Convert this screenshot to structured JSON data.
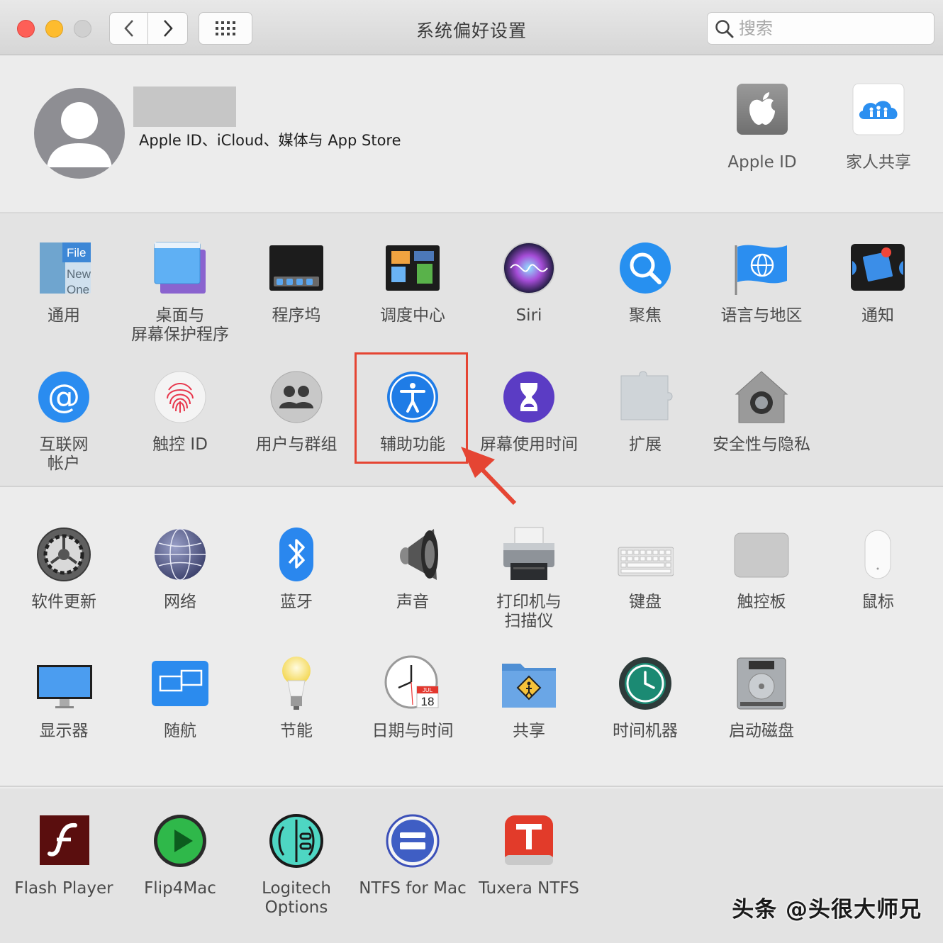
{
  "window": {
    "title": "系统偏好设置"
  },
  "search": {
    "placeholder": "搜索"
  },
  "apple_id": {
    "subtitle": "Apple ID、iCloud、媒体与 App Store"
  },
  "top_items": [
    {
      "label": "Apple ID",
      "icon": "apple-logo-icon"
    },
    {
      "label": "家人共享",
      "icon": "family-sharing-icon"
    }
  ],
  "prefs": [
    {
      "label": "通用",
      "icon": "general-icon"
    },
    {
      "label": "桌面与\n屏幕保护程序",
      "icon": "desktop-screensaver-icon"
    },
    {
      "label": "程序坞",
      "icon": "dock-icon"
    },
    {
      "label": "调度中心",
      "icon": "mission-control-icon"
    },
    {
      "label": "Siri",
      "icon": "siri-icon"
    },
    {
      "label": "聚焦",
      "icon": "spotlight-icon"
    },
    {
      "label": "语言与地区",
      "icon": "language-region-icon"
    },
    {
      "label": "通知",
      "icon": "notifications-icon"
    },
    {
      "label": "互联网\n帐户",
      "icon": "internet-accounts-icon"
    },
    {
      "label": "触控 ID",
      "icon": "touch-id-icon"
    },
    {
      "label": "用户与群组",
      "icon": "users-groups-icon"
    },
    {
      "label": "辅助功能",
      "icon": "accessibility-icon"
    },
    {
      "label": "屏幕使用时间",
      "icon": "screen-time-icon"
    },
    {
      "label": "扩展",
      "icon": "extensions-icon"
    },
    {
      "label": "安全性与隐私",
      "icon": "security-privacy-icon"
    },
    {
      "label": "软件更新",
      "icon": "software-update-icon"
    },
    {
      "label": "网络",
      "icon": "network-icon"
    },
    {
      "label": "蓝牙",
      "icon": "bluetooth-icon"
    },
    {
      "label": "声音",
      "icon": "sound-icon"
    },
    {
      "label": "打印机与\n扫描仪",
      "icon": "printer-icon"
    },
    {
      "label": "键盘",
      "icon": "keyboard-icon"
    },
    {
      "label": "触控板",
      "icon": "trackpad-icon"
    },
    {
      "label": "鼠标",
      "icon": "mouse-icon"
    },
    {
      "label": "显示器",
      "icon": "display-icon"
    },
    {
      "label": "随航",
      "icon": "sidecar-icon"
    },
    {
      "label": "节能",
      "icon": "energy-saver-icon"
    },
    {
      "label": "日期与时间",
      "icon": "date-time-icon"
    },
    {
      "label": "共享",
      "icon": "sharing-icon"
    },
    {
      "label": "时间机器",
      "icon": "time-machine-icon"
    },
    {
      "label": "启动磁盘",
      "icon": "startup-disk-icon"
    },
    {
      "label": "Flash Player",
      "icon": "flash-player-icon"
    },
    {
      "label": "Flip4Mac",
      "icon": "flip4mac-icon"
    },
    {
      "label": "Logitech Options",
      "icon": "logitech-options-icon"
    },
    {
      "label": "NTFS for Mac",
      "icon": "ntfs-for-mac-icon"
    },
    {
      "label": "Tuxera NTFS",
      "icon": "tuxera-ntfs-icon"
    }
  ],
  "icon_text": {
    "general_file": "File",
    "general_new": "New",
    "general_one": "One",
    "date_month": "JUL",
    "date_day": "18"
  },
  "watermark": "头条 @头很大师兄",
  "colors": {
    "highlight": "#e54533",
    "accent": "#1f7ce6"
  }
}
